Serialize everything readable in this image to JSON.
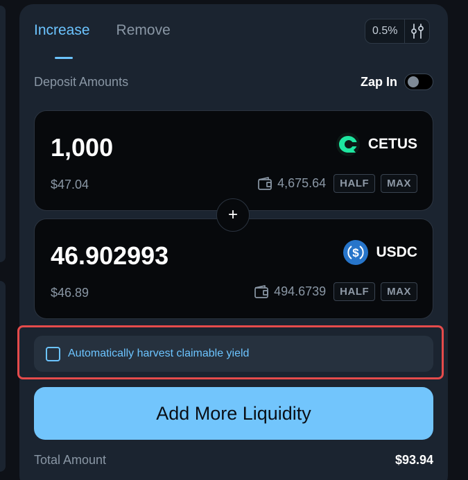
{
  "tabs": [
    {
      "label": "Increase",
      "active": true
    },
    {
      "label": "Remove",
      "active": false
    }
  ],
  "slippage": "0.5%",
  "deposit_label": "Deposit Amounts",
  "zap": {
    "label": "Zap In",
    "enabled": false
  },
  "tokens": [
    {
      "amount": "1,000",
      "symbol": "CETUS",
      "usd": "$47.04",
      "balance": "4,675.64",
      "icon": "cetus-icon",
      "color": "#1ee6a0"
    },
    {
      "amount": "46.902993",
      "symbol": "USDC",
      "usd": "$46.89",
      "balance": "494.6739",
      "icon": "usdc-icon",
      "color": "#2775ca"
    }
  ],
  "half_label": "HALF",
  "max_label": "MAX",
  "plus_symbol": "+",
  "harvest": {
    "label": "Automatically harvest claimable yield",
    "checked": false
  },
  "add_button": "Add More Liquidity",
  "total": {
    "label": "Total Amount",
    "value": "$93.94"
  },
  "colors": {
    "accent": "#6cc4ff",
    "button": "#72c5fc",
    "highlight": "#e54b4b"
  }
}
